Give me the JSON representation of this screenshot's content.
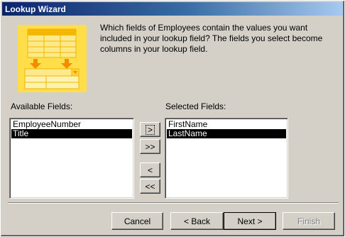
{
  "window": {
    "title": "Lookup Wizard"
  },
  "instructions": "Which fields of Employees contain the values you want included in your lookup field? The fields you select become columns in your lookup field.",
  "available": {
    "label": "Available Fields:",
    "items": [
      "EmployeeNumber",
      "Title"
    ],
    "selected_item": "Title"
  },
  "selected": {
    "label": "Selected Fields:",
    "items": [
      "FirstName",
      "LastName"
    ],
    "selected_item": "LastName"
  },
  "move_buttons": {
    "add_one": ">",
    "add_all": ">>",
    "remove_one": "<",
    "remove_all": "<<"
  },
  "footer": {
    "cancel": "Cancel",
    "back": "< Back",
    "next": "Next >",
    "finish": "Finish"
  },
  "colors": {
    "titlebar_start": "#0a246a",
    "titlebar_end": "#a6caf0",
    "illustration": "#ffde4a",
    "selection": "#000000"
  }
}
